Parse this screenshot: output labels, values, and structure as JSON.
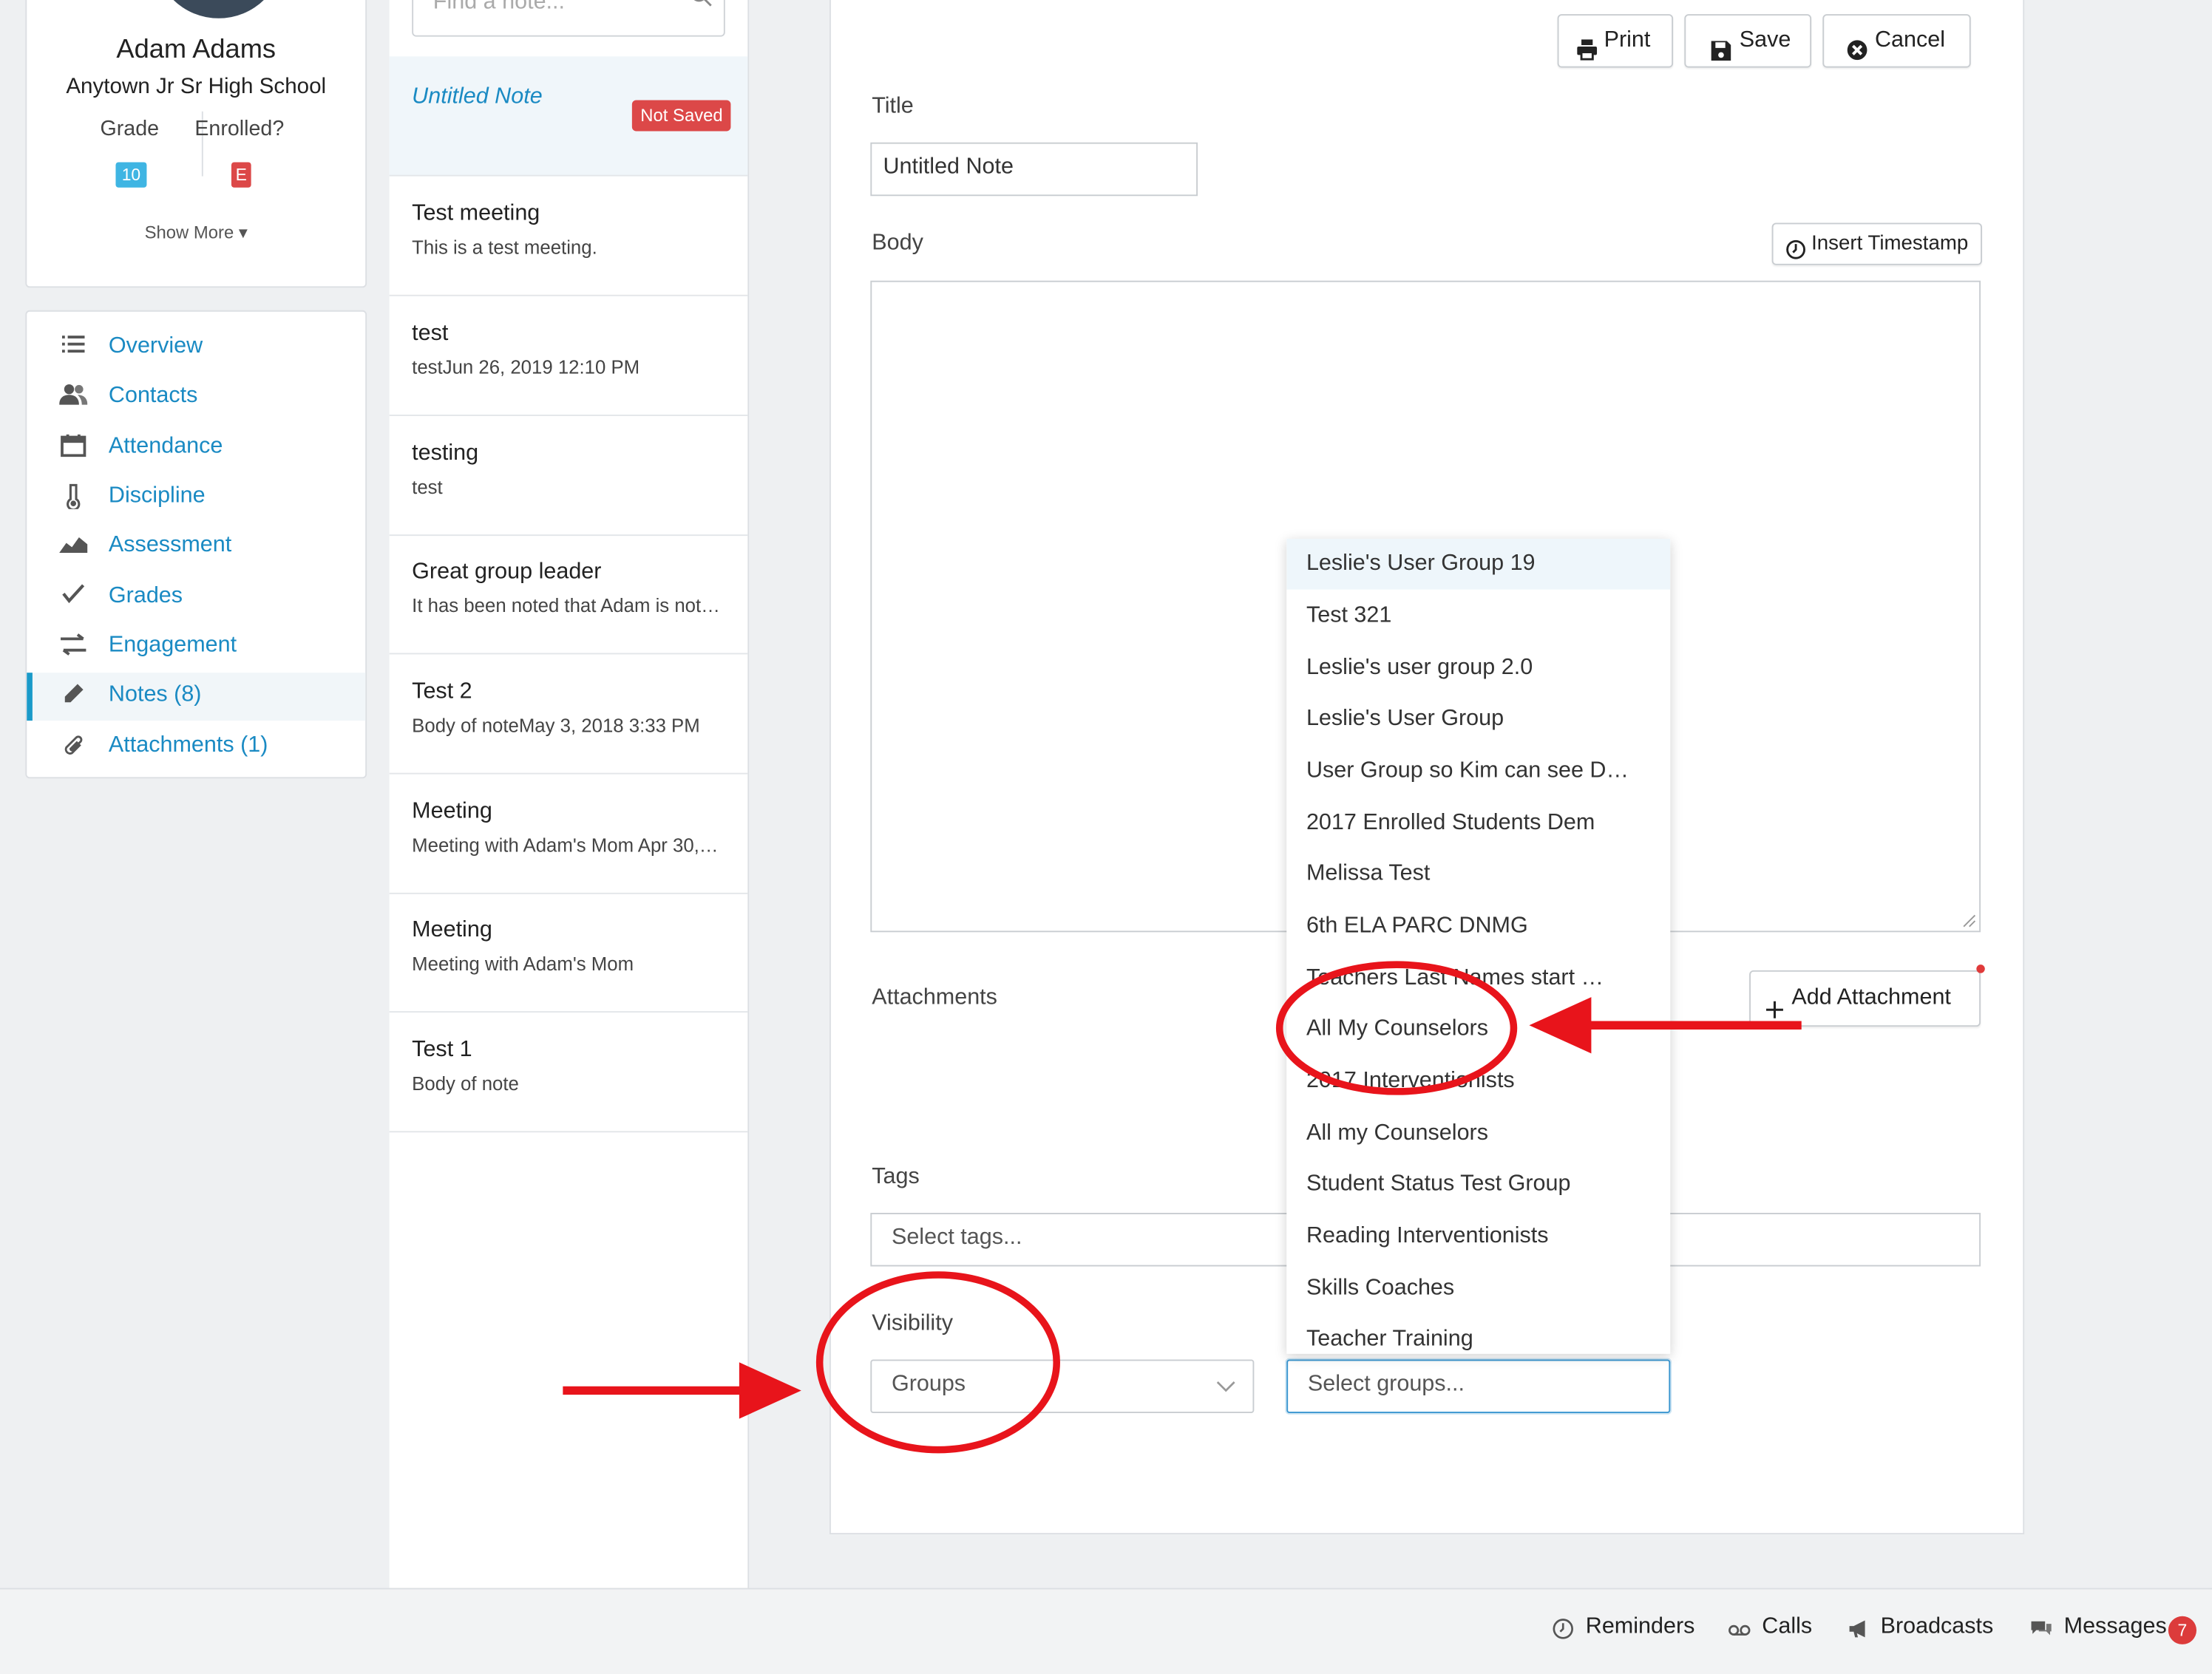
{
  "profile": {
    "name": "Adam Adams",
    "school": "Anytown Jr Sr High School",
    "grade_label": "Grade",
    "grade_value": "10",
    "enrolled_label": "Enrolled?",
    "enrolled_value": "E",
    "show_more": "Show More ▾"
  },
  "nav": {
    "items": [
      {
        "label": "Overview",
        "icon": "list-icon"
      },
      {
        "label": "Contacts",
        "icon": "users-icon"
      },
      {
        "label": "Attendance",
        "icon": "calendar-icon"
      },
      {
        "label": "Discipline",
        "icon": "thermometer-icon"
      },
      {
        "label": "Assessment",
        "icon": "area-chart-icon"
      },
      {
        "label": "Grades",
        "icon": "check-icon"
      },
      {
        "label": "Engagement",
        "icon": "exchange-icon"
      },
      {
        "label": "Notes (8)",
        "icon": "pencil-icon"
      },
      {
        "label": "Attachments (1)",
        "icon": "paperclip-icon"
      }
    ],
    "active": "Notes (8)"
  },
  "notes_list": {
    "search_placeholder": "Find a note...",
    "current": {
      "title": "Untitled Note",
      "status": "Not Saved"
    },
    "items": [
      {
        "title": "Test meeting",
        "body": "This is a test meeting."
      },
      {
        "title": "test",
        "body": "testJun 26, 2019 12:10 PM"
      },
      {
        "title": "testing",
        "body": "test"
      },
      {
        "title": "Great group leader",
        "body": "It has been noted that Adam is not…"
      },
      {
        "title": "Test 2",
        "body": "Body of noteMay 3, 2018 3:33 PM"
      },
      {
        "title": "Meeting",
        "body": "Meeting with Adam's Mom Apr 30,…"
      },
      {
        "title": "Meeting",
        "body": "Meeting with Adam's Mom"
      },
      {
        "title": "Test 1",
        "body": "Body of note"
      }
    ]
  },
  "toolbar": {
    "print_label": "Print",
    "save_label": "Save",
    "cancel_label": "Cancel"
  },
  "form": {
    "title_label": "Title",
    "title_value": "Untitled Note",
    "body_label": "Body",
    "insert_timestamp_label": "Insert Timestamp",
    "attachments_label": "Attachments",
    "add_attachment_label": "Add Attachment",
    "tags_label": "Tags",
    "tags_placeholder": "Select tags...",
    "visibility_label": "Visibility",
    "visibility_value": "Groups",
    "groups_placeholder": "Select groups..."
  },
  "groups_dropdown": {
    "options": [
      "Leslie's User Group 19",
      "Test 321",
      "Leslie's user group 2.0",
      "Leslie's User Group",
      "User Group so Kim can see D…",
      "2017 Enrolled Students Dem",
      "Melissa Test",
      "6th ELA PARC DNMG",
      "Teachers Last Names start …",
      "All My Counselors",
      "2017 Interventionists",
      "All my Counselors",
      "Student Status Test Group",
      "Reading Interventionists",
      "Skills Coaches",
      "Teacher Training"
    ],
    "highlighted": "Leslie's User Group 19"
  },
  "footer": {
    "reminders": "Reminders",
    "calls": "Calls",
    "broadcasts": "Broadcasts",
    "messages": "Messages",
    "messages_count": "7"
  },
  "colors": {
    "accent": "#1a8ac3",
    "grade_badge": "#3fb5e3",
    "enrolled_badge": "#dc4848",
    "not_saved_badge": "#dc4848",
    "annotation": "#e8141b"
  }
}
